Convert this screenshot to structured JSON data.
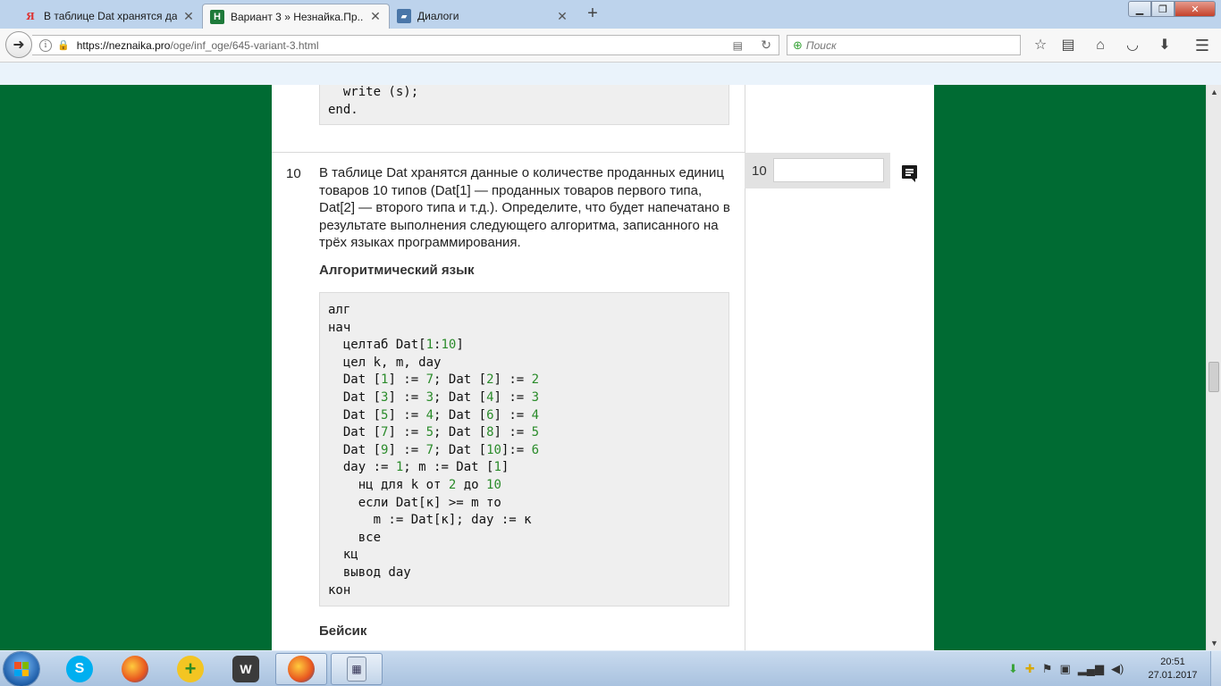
{
  "browser": {
    "tabs": [
      {
        "title": "В таблице Dat хранятся да...",
        "icon": "yandex-icon",
        "active": false
      },
      {
        "title": "Вариант 3 » Незнайка.Пр...",
        "icon": "neznaika-icon",
        "active": true
      },
      {
        "title": "Диалоги",
        "icon": "vk-icon",
        "active": false
      }
    ],
    "url_domain": "https://neznaika.pro",
    "url_path": "/oge/inf_oge/645-variant-3.html",
    "search_placeholder": "Поиск"
  },
  "page": {
    "prev_code": [
      "  write (s);",
      "end."
    ],
    "question": {
      "number": "10",
      "text": "В таблице Dat хранятся данные о количестве проданных единиц товаров 10 типов (Dat[1] — проданных товаров первого типа, Dat[2] — второго типа и т.д.). Определите, что будет напечатано в результате выполнения следующего алгоритма, записанного на трёх языках программирования.",
      "alg_heading": "Алгоритмический язык",
      "alg_code": [
        "алг",
        "нач",
        "  целтаб Dat[1:10]",
        "  цел k, m, day",
        "  Dat [1] := 7; Dat [2] := 2",
        "  Dat [3] := 3; Dat [4] := 3",
        "  Dat [5] := 4; Dat [6] := 4",
        "  Dat [7] := 5; Dat [8] := 5",
        "  Dat [9] := 7; Dat [10]:= 6",
        "  day := 1; m := Dat [1]",
        "    нц для k от 2 до 10",
        "    если Dat[к] >= m то",
        "      m := Dat[к]; day := к",
        "    все",
        "  кц",
        "  вывод day",
        "кон"
      ],
      "basic_heading": "Бейсик"
    },
    "answer": {
      "number": "10",
      "value": ""
    }
  },
  "taskbar": {
    "clock_time": "20:51",
    "clock_date": "27.01.2017"
  },
  "colors": {
    "background_green": "#006b33",
    "code_bg": "#efefef",
    "code_number": "#2a8b2a"
  }
}
